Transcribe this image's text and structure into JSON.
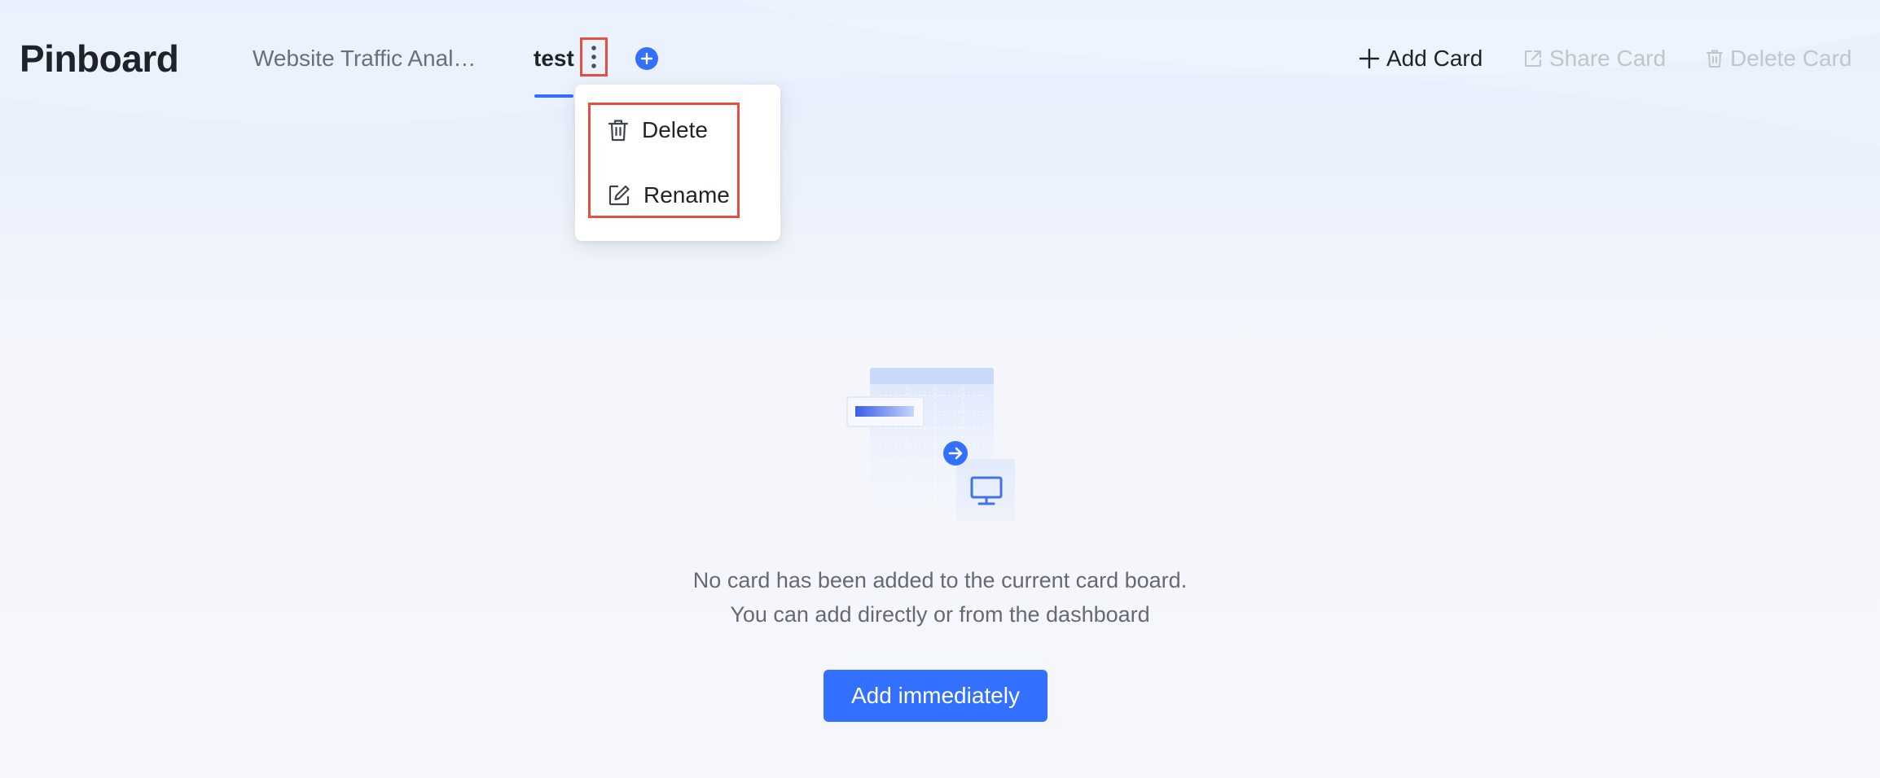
{
  "header": {
    "app_title": "Pinboard",
    "tabs": [
      {
        "label": "Website Traffic Anal…",
        "active": false
      },
      {
        "label": "test",
        "active": true
      }
    ],
    "actions": {
      "add_card": "Add Card",
      "share_card": "Share Card",
      "delete_card": "Delete Card"
    }
  },
  "tab_menu": {
    "items": [
      {
        "label": "Delete",
        "icon": "trash-icon"
      },
      {
        "label": "Rename",
        "icon": "edit-icon"
      }
    ]
  },
  "empty_state": {
    "line1": "No card has been added to the current card board.",
    "line2": "You can add directly or from the dashboard",
    "button_label": "Add immediately"
  },
  "colors": {
    "accent": "#3370ff",
    "highlight": "#e5503f",
    "text_primary": "#1f2329",
    "text_secondary": "#646a73",
    "text_disabled": "#c1c5cc"
  }
}
